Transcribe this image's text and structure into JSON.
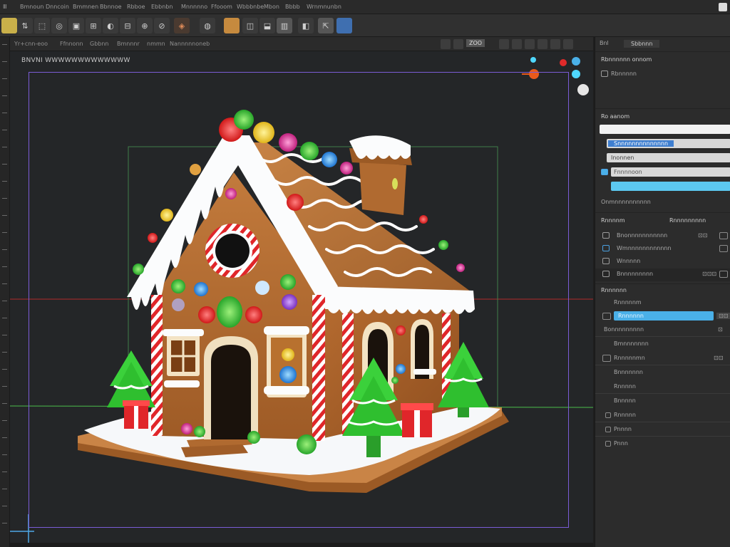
{
  "menu": {
    "items": [
      "Ⅲ",
      "Bmnoun",
      "Dnncoin",
      "Bmmnen",
      "Bbnnoe",
      "Rbboe",
      "Ebbnbn",
      "Mnnnnno",
      "Ffooom",
      "Wbbbnbe",
      "Mbon",
      "Bbbb",
      "Wrnmnunbn"
    ]
  },
  "toolbar": {
    "buttons": [
      "▤",
      "⇅",
      "⬚",
      "◎",
      "▣",
      "⊞",
      "◐",
      "⊟",
      "⊕",
      "⊘",
      "◈",
      "◍",
      "▦",
      "◫",
      "⬓",
      "▥",
      "◧",
      "⇱",
      "◩",
      "◪"
    ]
  },
  "viewport_header": {
    "labels": [
      "Yr+cnn-eoo",
      "Ffnnonn",
      "Gbbnn",
      "Bmnnnr",
      "nmmn",
      "Nannnnnoneb"
    ],
    "right_readout": [
      "⊞",
      "⊡",
      "ZOO",
      "⊟",
      "⊕",
      "⊘"
    ]
  },
  "viewport": {
    "view_name": "BNVNI WWWWWWWWWWWWW",
    "axis_colors": {
      "x": "#d23a3a",
      "y": "#4bbd4b",
      "frame": "#7a5cd6"
    }
  },
  "right_panel": {
    "tab_label": "Bnl",
    "tab_active": "Sbbnnn",
    "header": "Rbnnnnnn onnom",
    "sub_item": "Rbnnnnn",
    "material_section": "Ro aanom",
    "material_rows": [
      "Snnnnnnnnnnnnnn",
      "Inonnen",
      "Fnnnnoon"
    ],
    "material_footer": "Onmnnnnnnnnnn",
    "outliner_header": [
      "Rnnnnm",
      "Rnnnnnnnnn"
    ],
    "outliner_rows": [
      "Bnonnnnnnnnnnn",
      "Wmnnnnnnnnnnnn",
      "Wnnnnn",
      "Bnnnnnnnnn"
    ],
    "props_header": "Rnnnnnn",
    "props_rows": [
      "Rnnnnnm",
      "Rnnnnnn",
      "Bonnnnnnnnn",
      "Bmnnnnnnn",
      "Rnnnnnmn",
      "Bnnnnnnn",
      "Rnnnnn",
      "Bnnnnn",
      "Rnnnnn",
      "Pnnnn",
      "Pnnn"
    ],
    "values": [
      "⊡⊡",
      "⊡",
      "⊡⊡",
      "⊡⊡⊡",
      "⊡⊡"
    ],
    "colors": {
      "accent": "#4ab0e8",
      "panel": "#2c2c2c"
    }
  }
}
